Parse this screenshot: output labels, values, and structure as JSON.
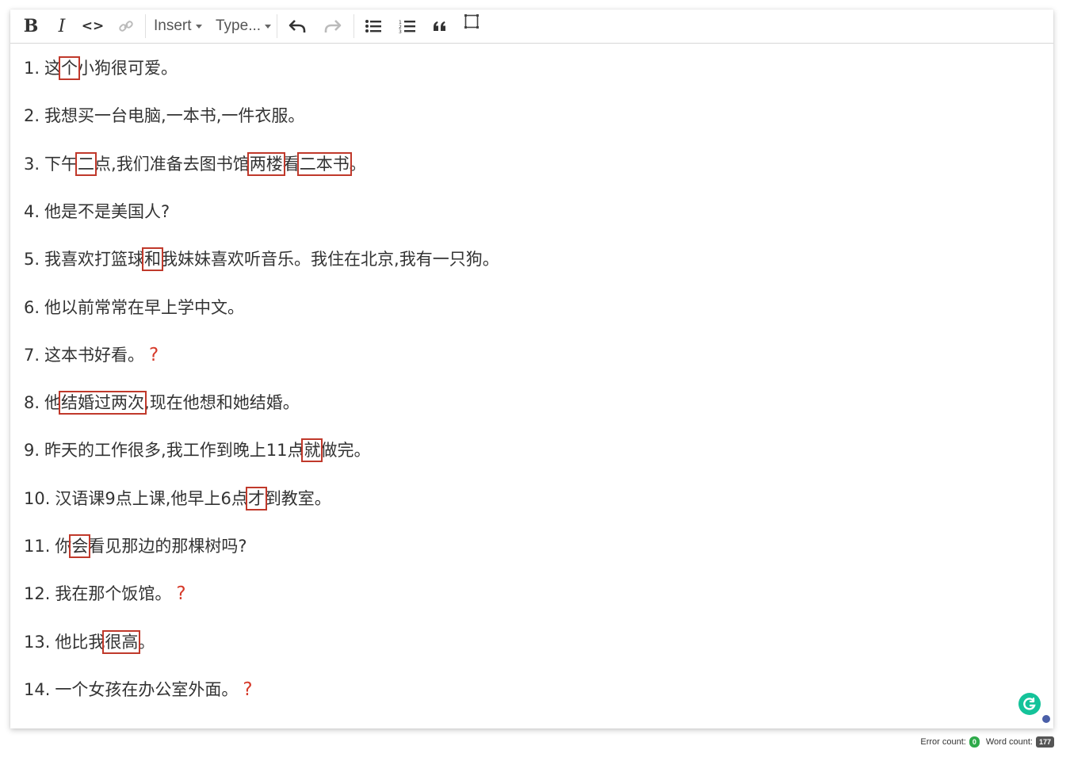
{
  "toolbar": {
    "bold": "B",
    "italic": "I",
    "code": "<>",
    "insert_label": "Insert",
    "type_label": "Type..."
  },
  "sentences": [
    {
      "num": "1.",
      "segments": [
        {
          "text": "这",
          "hl": false
        },
        {
          "text": "个",
          "hl": true
        },
        {
          "text": "小狗很可爱。",
          "hl": false
        }
      ],
      "question": false
    },
    {
      "num": "2.",
      "segments": [
        {
          "text": "我想买一台电脑,一本书,一件衣服。",
          "hl": false
        }
      ],
      "question": false
    },
    {
      "num": "3.",
      "segments": [
        {
          "text": "下午",
          "hl": false
        },
        {
          "text": "二",
          "hl": true
        },
        {
          "text": "点,我们准备去图书馆",
          "hl": false
        },
        {
          "text": "两楼",
          "hl": true
        },
        {
          "text": "看",
          "hl": false
        },
        {
          "text": "二本书",
          "hl": true
        },
        {
          "text": "。",
          "hl": false
        }
      ],
      "question": false
    },
    {
      "num": "4.",
      "segments": [
        {
          "text": "他是不是美国人?",
          "hl": false
        }
      ],
      "question": false
    },
    {
      "num": "5.",
      "segments": [
        {
          "text": "我喜欢打篮球",
          "hl": false
        },
        {
          "text": "和",
          "hl": true
        },
        {
          "text": "我妹妹喜欢听音乐。我住在北京,我有一只狗。",
          "hl": false
        }
      ],
      "question": false
    },
    {
      "num": "6.",
      "segments": [
        {
          "text": "他以前常常在早上学中文。",
          "hl": false
        }
      ],
      "question": false
    },
    {
      "num": "7.",
      "segments": [
        {
          "text": "这本书好看。",
          "hl": false
        }
      ],
      "question": true
    },
    {
      "num": "8.",
      "segments": [
        {
          "text": "他",
          "hl": false
        },
        {
          "text": "结婚过两次",
          "hl": true
        },
        {
          "text": ",现在他想和她结婚。",
          "hl": false
        }
      ],
      "question": false
    },
    {
      "num": "9.",
      "segments": [
        {
          "text": "昨天的工作很多,我工作到晚上11点",
          "hl": false
        },
        {
          "text": "就",
          "hl": true
        },
        {
          "text": "做完。",
          "hl": false
        }
      ],
      "question": false
    },
    {
      "num": "10.",
      "segments": [
        {
          "text": "汉语课9点上课,他早上6点",
          "hl": false
        },
        {
          "text": "才",
          "hl": true
        },
        {
          "text": "到教室。",
          "hl": false
        }
      ],
      "question": false
    },
    {
      "num": "11.",
      "segments": [
        {
          "text": "你",
          "hl": false
        },
        {
          "text": "会",
          "hl": true
        },
        {
          "text": "看见那边的那棵树吗?",
          "hl": false
        }
      ],
      "question": false
    },
    {
      "num": "12.",
      "segments": [
        {
          "text": "我在那个饭馆。",
          "hl": false
        }
      ],
      "question": true
    },
    {
      "num": "13.",
      "segments": [
        {
          "text": "他比我",
          "hl": false
        },
        {
          "text": "很高",
          "hl": true
        },
        {
          "text": "。",
          "hl": false
        }
      ],
      "question": false
    },
    {
      "num": "14.",
      "segments": [
        {
          "text": "一个女孩在办公室外面。",
          "hl": false
        }
      ],
      "question": true
    }
  ],
  "question_mark": "?",
  "status": {
    "error_label": "Error count:",
    "error_count": "0",
    "word_label": "Word count:",
    "word_count": "177"
  },
  "colors": {
    "highlight": "#c0392b",
    "question": "#d63a2a",
    "assistant": "#15c39a"
  }
}
